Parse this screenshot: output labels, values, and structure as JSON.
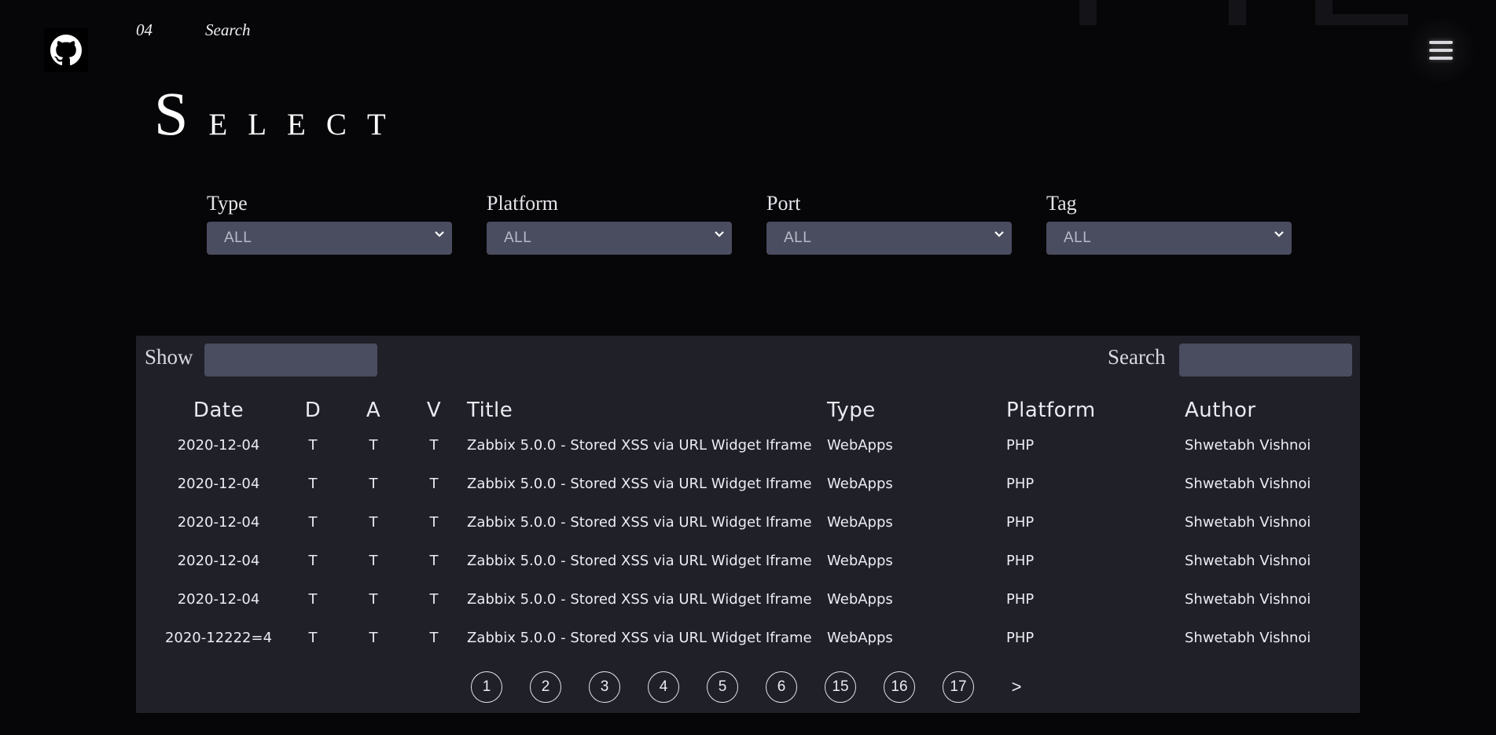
{
  "header": {
    "nav": [
      {
        "label": "04"
      },
      {
        "label": "Search"
      }
    ]
  },
  "page_title": "Select",
  "filters": [
    {
      "label": "Type",
      "value": "ALL"
    },
    {
      "label": "Platform",
      "value": "ALL"
    },
    {
      "label": "Port",
      "value": "ALL"
    },
    {
      "label": "Tag",
      "value": "ALL"
    }
  ],
  "table_controls": {
    "show_label": "Show",
    "show_value": "",
    "search_label": "Search",
    "search_value": ""
  },
  "table": {
    "columns": [
      "Date",
      "D",
      "A",
      "V",
      "Title",
      "Type",
      "Platform",
      "Author"
    ],
    "rows": [
      {
        "date": "2020-12-04",
        "d": "T",
        "a": "T",
        "v": "T",
        "title": "Zabbix 5.0.0 - Stored XSS via URL Widget Iframe",
        "type": "WebApps",
        "platform": "PHP",
        "author": "Shwetabh Vishnoi"
      },
      {
        "date": "2020-12-04",
        "d": "T",
        "a": "T",
        "v": "T",
        "title": "Zabbix 5.0.0 - Stored XSS via URL Widget Iframe",
        "type": "WebApps",
        "platform": "PHP",
        "author": "Shwetabh Vishnoi"
      },
      {
        "date": "2020-12-04",
        "d": "T",
        "a": "T",
        "v": "T",
        "title": "Zabbix 5.0.0 - Stored XSS via URL Widget Iframe",
        "type": "WebApps",
        "platform": "PHP",
        "author": "Shwetabh Vishnoi"
      },
      {
        "date": "2020-12-04",
        "d": "T",
        "a": "T",
        "v": "T",
        "title": "Zabbix 5.0.0 - Stored XSS via URL Widget Iframe",
        "type": "WebApps",
        "platform": "PHP",
        "author": "Shwetabh Vishnoi"
      },
      {
        "date": "2020-12-04",
        "d": "T",
        "a": "T",
        "v": "T",
        "title": "Zabbix 5.0.0 - Stored XSS via URL Widget Iframe",
        "type": "WebApps",
        "platform": "PHP",
        "author": "Shwetabh Vishnoi"
      },
      {
        "date": "2020-12222=4",
        "d": "T",
        "a": "T",
        "v": "T",
        "title": "Zabbix 5.0.0 - Stored XSS via URL Widget Iframe",
        "type": "WebApps",
        "platform": "PHP",
        "author": "Shwetabh Vishnoi"
      }
    ]
  },
  "pagination": {
    "pages": [
      "1",
      "2",
      "3",
      "4",
      "5",
      "6",
      "15",
      "16",
      "17"
    ],
    "next_label": ">"
  },
  "icons": {
    "github": "github-icon",
    "menu": "hamburger-menu-icon",
    "dropdown": "chevron-down-icon"
  },
  "colors": {
    "background": "#060608",
    "panel": "#1f2028",
    "field": "#4a4c60"
  }
}
